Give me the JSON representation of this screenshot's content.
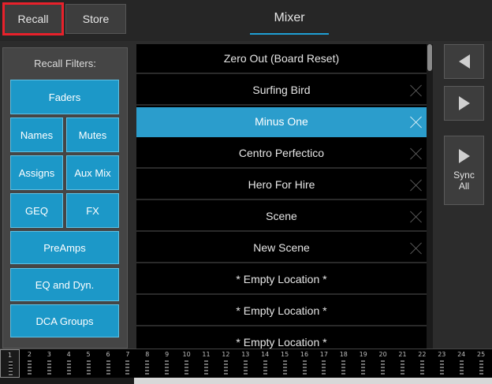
{
  "header": {
    "recall_label": "Recall",
    "store_label": "Store",
    "title": "Mixer"
  },
  "filters": {
    "title": "Recall Filters:",
    "buttons": [
      "Faders",
      "Names",
      "Mutes",
      "Assigns",
      "Aux Mix",
      "GEQ",
      "FX",
      "PreAmps",
      "EQ and Dyn.",
      "DCA Groups"
    ]
  },
  "scenes": [
    {
      "label": "Zero Out (Board Reset)",
      "deletable": false,
      "selected": false
    },
    {
      "label": "Surfing Bird",
      "deletable": true,
      "selected": false
    },
    {
      "label": "Minus One",
      "deletable": true,
      "selected": true
    },
    {
      "label": "Centro Perfectico",
      "deletable": true,
      "selected": false
    },
    {
      "label": "Hero For Hire",
      "deletable": true,
      "selected": false
    },
    {
      "label": "Scene",
      "deletable": true,
      "selected": false
    },
    {
      "label": "New Scene",
      "deletable": true,
      "selected": false
    },
    {
      "label": "* Empty Location *",
      "deletable": false,
      "selected": false
    },
    {
      "label": "* Empty Location *",
      "deletable": false,
      "selected": false
    },
    {
      "label": "* Empty Location *",
      "deletable": false,
      "selected": false
    }
  ],
  "nav": {
    "prev_icon": "triangle-left-icon",
    "next_icon": "triangle-right-icon",
    "sync_label_line1": "Sync",
    "sync_label_line2": "All"
  },
  "channels": [
    "1",
    "2",
    "3",
    "4",
    "5",
    "6",
    "7",
    "8",
    "9",
    "10",
    "11",
    "12",
    "13",
    "14",
    "15",
    "16",
    "17",
    "18",
    "19",
    "20",
    "21",
    "22",
    "23",
    "24",
    "25"
  ],
  "active_channel": "1",
  "colors": {
    "accent": "#1c98c8",
    "selected_row": "#2b9dcc",
    "recall_highlight": "#e8212b"
  }
}
